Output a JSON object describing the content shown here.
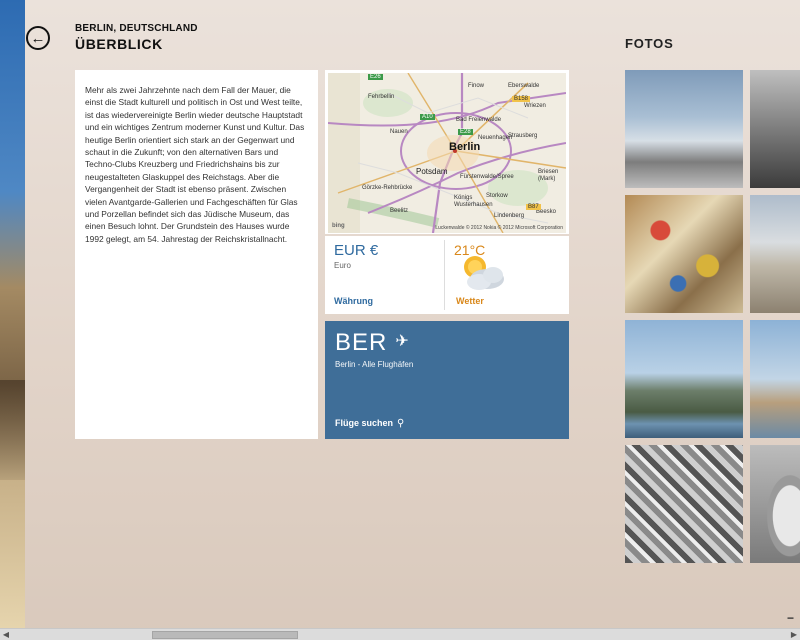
{
  "header": {
    "city": "BERLIN, DEUTSCHLAND",
    "section": "ÜBERBLICK"
  },
  "photos": {
    "title": "FOTOS"
  },
  "description": "Mehr als zwei Jahrzehnte nach dem Fall der Mauer, die einst die Stadt kulturell und politisch in Ost und West teilte, ist das wiedervereinigte Berlin wieder deutsche Hauptstadt und ein wichtiges Zentrum moderner Kunst und Kultur. Das heutige Berlin orientiert sich stark an der Gegenwart und schaut in die Zukunft; von den alternativen Bars und Techno-Clubs Kreuzberg und Friedrichshains bis zur neugestalteten Glaskuppel des Reichstags. Aber die Vergangenheit der Stadt ist ebenso präsent. Zwischen vielen Avantgarde-Gallerien und Fachgeschäften für Glas und Porzellan befindet sich das Jüdische Museum, das einen Besuch lohnt. Der Grundstein des Hauses wurde 1992 gelegt, am 54. Jahrestag der Reichskristallnacht.",
  "map": {
    "main_city": "Berlin",
    "places": {
      "p0": "Finow",
      "p1": "Eberswalde",
      "p2": "Bad Freienwalde",
      "p3": "Wriezen",
      "p4": "Fehrbellin",
      "p5": "Nauen",
      "p6": "Neuenhagen",
      "p7": "Strausberg",
      "p8": "Potsdam",
      "p9": "Fürstenwalde/Spree",
      "p10": "Briesen (Mark)",
      "p11": "Königs Wusterhausen",
      "p12": "Storkow",
      "p13": "Beelitz",
      "p14": "Lindenberg",
      "p15": "Beesko",
      "p16": "Görzke-Rehbrücke"
    },
    "roads": {
      "r0": "E26",
      "r1": "A10",
      "r2": "E28",
      "r3": "B158",
      "r4": "B87"
    },
    "credit": "Luckenwalde © 2012 Nokia © 2012 Microsoft Corporation",
    "provider": "bing"
  },
  "currency": {
    "code": "EUR €",
    "name": "Euro",
    "link": "Währung"
  },
  "weather": {
    "temp": "21°C",
    "link": "Wetter"
  },
  "flights": {
    "code": "BER",
    "subtitle": "Berlin - Alle Flughäfen",
    "link": "Flüge suchen"
  },
  "scroll": {
    "zoom_label": "−"
  },
  "icons": {
    "back": "back-arrow-icon",
    "plane": "plane-icon",
    "search": "search-icon",
    "weather": "partly-cloudy-icon"
  },
  "colors": {
    "accent_blue": "#3f6e98",
    "weather_orange": "#d9881b"
  }
}
